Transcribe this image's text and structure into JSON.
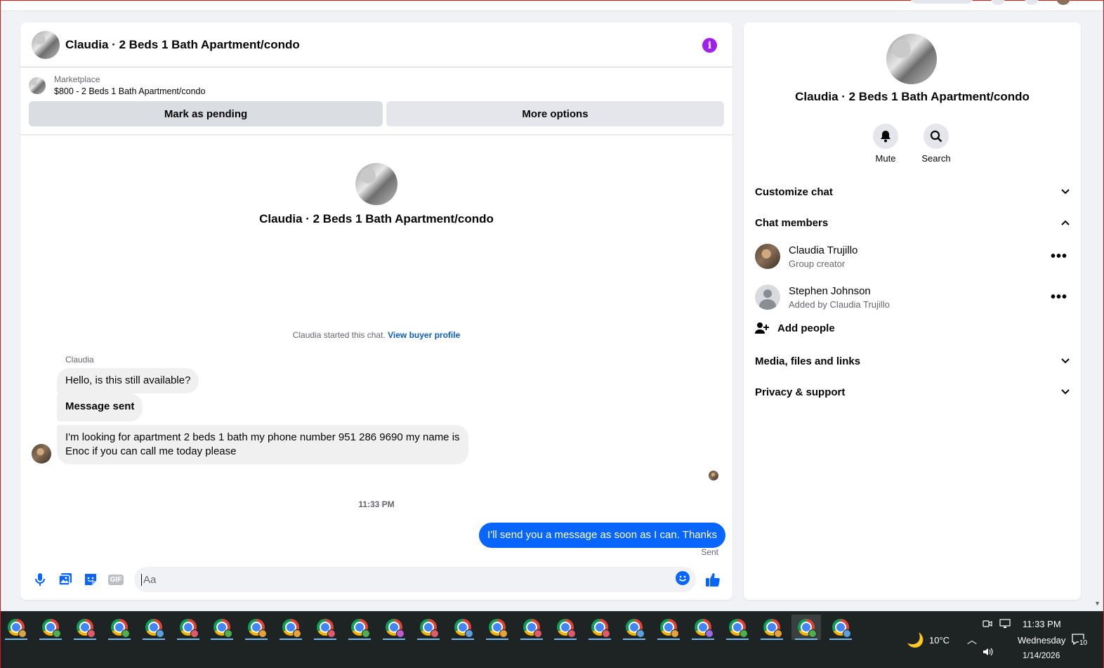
{
  "chat": {
    "title": "Claudia · 2 Beds 1 Bath Apartment/condo",
    "listing_label": "Marketplace",
    "listing_desc": "$800 - 2 Beds 1 Bath Apartment/condo",
    "mark_pending": "Mark as pending",
    "more_options": "More options",
    "intro_name": "Claudia · 2 Beds 1 Bath Apartment/condo",
    "started_text": "Claudia started this chat.",
    "view_buyer": "View buyer profile",
    "sender_name": "Claudia",
    "messages": [
      "Hello, is this still available?",
      "Message sent",
      "I'm looking for apartment 2 beds 1 bath my phone number 951 286 9690 my name is Enoc if you can call me today please"
    ],
    "timestamp": "11:33 PM",
    "outgoing": "I'll send you a message as soon as I can. Thanks",
    "sent_label": "Sent",
    "input_placeholder": "Aa",
    "gif_label": "GIF"
  },
  "details": {
    "title": "Claudia · 2 Beds 1 Bath Apartment/condo",
    "mute": "Mute",
    "search": "Search",
    "customize": "Customize chat",
    "members_header": "Chat members",
    "members": [
      {
        "name": "Claudia Trujillo",
        "role": "Group creator"
      },
      {
        "name": "Stephen Johnson",
        "role": "Added by Claudia Trujillo"
      }
    ],
    "add_people": "Add people",
    "media": "Media, files and links",
    "privacy": "Privacy & support"
  },
  "taskbar": {
    "temperature": "10°C",
    "time": "11:33 PM",
    "day": "Wednesday",
    "date": "1/14/2026",
    "notifications": "10"
  },
  "colors": {
    "accent": "#0866ff",
    "info": "#a020f0",
    "link": "#0a5ec4"
  }
}
